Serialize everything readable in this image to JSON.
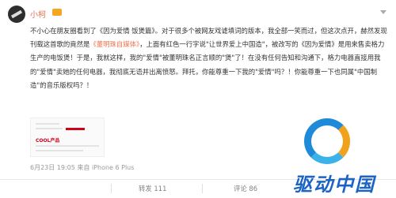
{
  "post": {
    "author": "小柯",
    "text_parts": [
      {
        "t": "不小心在朋友圈看到了《因为爱情 饭煲篇》。对于很多个被网友戏谑填词的版本，我全部一笑而过，但这次点开，赫然发现刊载这首歌的竟然是",
        "hl": false
      },
      {
        "t": "《董明珠自媒体》",
        "hl": true
      },
      {
        "t": "，上面有红色一行字说\"让世界爱上中国造\"，被改写的《因为爱情》是用来售卖格力生产的电饭煲！于是，我就这样，我的\"爱情\"被董明珠名正言顺的\"煲\"了！在没有任何告知和沟通下，格力电器直接用我的\"爱情\"卖她的任何电器，我彻底无语并出离愤怒。拜托，你能尊重一下我的\"爱情\"吗？！你能尊重一下也同属\"中国制造\"的音乐版权吗？！",
        "hl": false
      }
    ],
    "meta": "6月23日 19:05 来自 iPhone 6 Plus",
    "repost_label": "转发 111",
    "comment_label": "评论 86"
  },
  "thumbnail": {
    "brand_text": "COOL产品"
  },
  "watermark": {
    "text": "驱动中国"
  },
  "colors": {
    "accent": "#eb7350",
    "brand_blue": "#1b63c4"
  }
}
